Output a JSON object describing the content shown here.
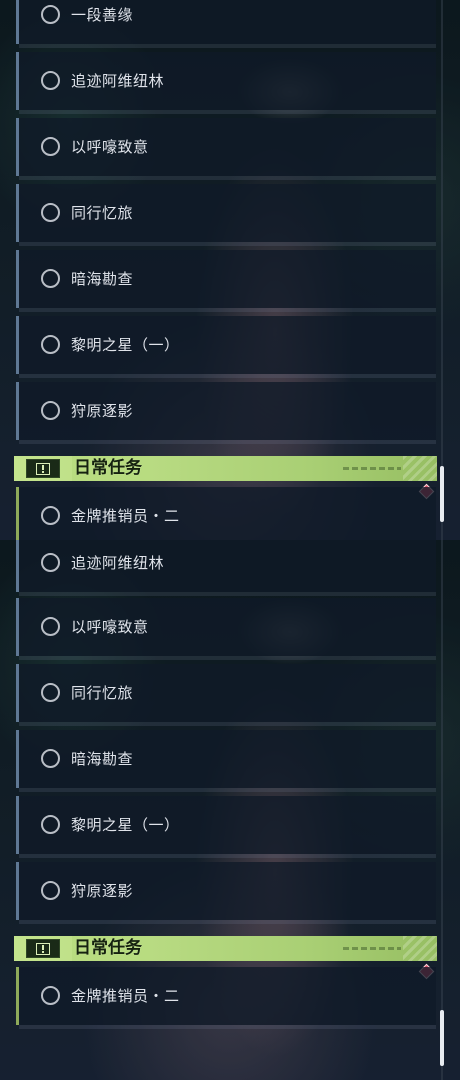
{
  "panels": [
    {
      "quest_list": [
        {
          "label": "一段善缘",
          "status_icon": "circle-ring-icon"
        },
        {
          "label": "追迹阿维纽林",
          "status_icon": "circle-ring-icon"
        },
        {
          "label": "以呼嚎致意",
          "status_icon": "circle-ring-icon"
        },
        {
          "label": "同行忆旅",
          "status_icon": "circle-ring-icon"
        },
        {
          "label": "暗海勘查",
          "status_icon": "circle-ring-icon"
        },
        {
          "label": "黎明之星（一）",
          "status_icon": "circle-ring-icon"
        },
        {
          "label": "狩原逐影",
          "status_icon": "circle-ring-icon"
        }
      ],
      "daily_section": {
        "title": "日常任务",
        "icon": "exclamation-box-icon",
        "quests": [
          {
            "label": "金牌推销员・二",
            "status_icon": "circle-ring-icon"
          }
        ]
      },
      "marker_icon": "red-diamond-icon",
      "scroll_fraction": 0.93
    },
    {
      "quest_list": [
        {
          "label": "追迹阿维纽林",
          "status_icon": "circle-ring-icon"
        },
        {
          "label": "以呼嚎致意",
          "status_icon": "circle-ring-icon"
        },
        {
          "label": "同行忆旅",
          "status_icon": "circle-ring-icon"
        },
        {
          "label": "暗海勘查",
          "status_icon": "circle-ring-icon"
        },
        {
          "label": "黎明之星（一）",
          "status_icon": "circle-ring-icon"
        },
        {
          "label": "狩原逐影",
          "status_icon": "circle-ring-icon"
        }
      ],
      "daily_section": {
        "title": "日常任务",
        "icon": "exclamation-box-icon",
        "quests": [
          {
            "label": "金牌推销员・二",
            "status_icon": "circle-ring-icon"
          }
        ]
      },
      "marker_icon": "red-diamond-icon",
      "scroll_fraction": 1.0
    }
  ],
  "colors": {
    "row_accent": "#5f7894",
    "daily_accent": "#8faa5a",
    "header_green": "#b8dc80",
    "marker_red": "#d94b63"
  }
}
